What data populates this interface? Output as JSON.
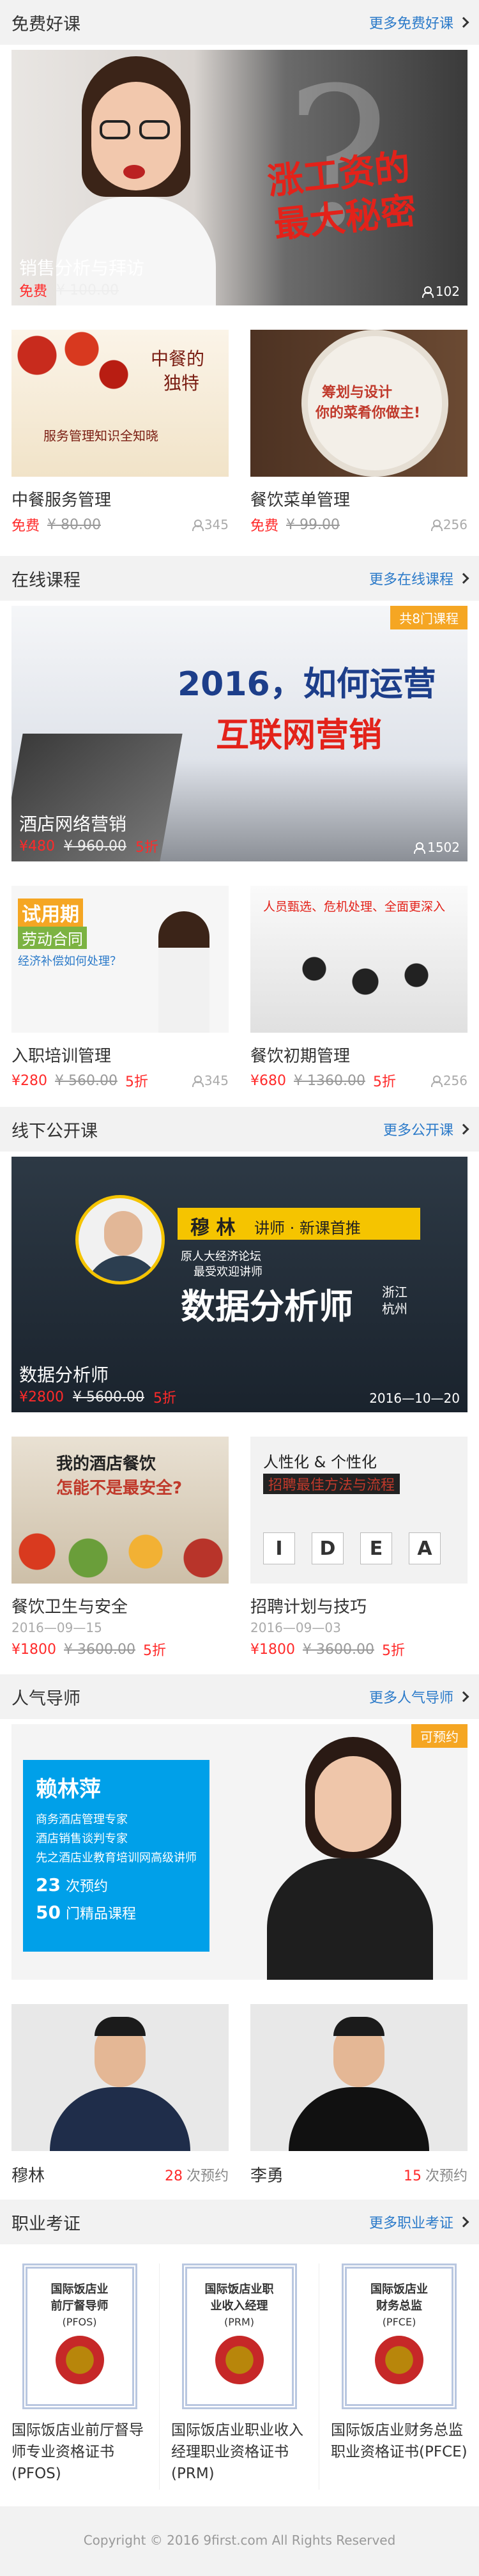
{
  "free": {
    "title": "免费好课",
    "more": "更多免费好课",
    "hero": {
      "caption": "销售分析与拜访",
      "price": "免费",
      "orig": "¥ 100.00",
      "count": "102",
      "banner_line1": "涨工资的",
      "banner_line2": "最大秘密"
    },
    "cards": [
      {
        "name": "中餐服务管理",
        "price": "免费",
        "orig": "¥ 80.00",
        "count": "345",
        "art1": "中餐的",
        "art2": "独特",
        "art3": "服务管理知识全知晓"
      },
      {
        "name": "餐饮菜单管理",
        "price": "免费",
        "orig": "¥ 99.00",
        "count": "256",
        "art1": "筹划与设计",
        "art2": "你的菜肴你做主!"
      }
    ]
  },
  "online": {
    "title": "在线课程",
    "more": "更多在线课程",
    "hero": {
      "caption": "酒店网络营销",
      "tag": "共8门课程",
      "price": "¥480",
      "orig": "¥ 960.00",
      "discount": "5折",
      "count": "1502",
      "banner_line1": "2016，如何运营",
      "banner_line2": "互联网营销"
    },
    "cards": [
      {
        "name": "入职培训管理",
        "price": "¥280",
        "orig": "¥ 560.00",
        "discount": "5折",
        "count": "345",
        "art1": "试用期",
        "art2": "劳动合同",
        "art3": "经济补偿如何处理？"
      },
      {
        "name": "餐饮初期管理",
        "price": "¥680",
        "orig": "¥ 1360.00",
        "discount": "5折",
        "count": "256",
        "art1": "人员甄选、危机处理、全面更深入"
      }
    ]
  },
  "offline": {
    "title": "线下公开课",
    "more": "更多公开课",
    "hero": {
      "caption": "数据分析师",
      "price": "¥2800",
      "orig": "¥ 5600.00",
      "discount": "5折",
      "date": "2016—10—20",
      "teacher": "穆 林",
      "teacher_role": "讲师 · 新课首推",
      "teacher_desc": "原人大经济论坛",
      "teacher_desc2": "最受欢迎讲师",
      "big": "数据分析师",
      "city1": "浙江",
      "city2": "杭州"
    },
    "cards": [
      {
        "name": "餐饮卫生与安全",
        "date": "2016—09—15",
        "price": "¥1800",
        "orig": "¥ 3600.00",
        "discount": "5折",
        "art1": "我的酒店餐饮",
        "art2": "怎能不是最安全?"
      },
      {
        "name": "招聘计划与技巧",
        "date": "2016—09—03",
        "price": "¥1800",
        "orig": "¥ 3600.00",
        "discount": "5折",
        "art1": "人性化 & 个性化",
        "art2": "招聘最佳方法与流程",
        "letters": [
          "I",
          "D",
          "E",
          "A"
        ]
      }
    ]
  },
  "mentor": {
    "title": "人气导师",
    "more": "更多人气导师",
    "hero": {
      "tag": "可预约",
      "name": "赖林萍",
      "desc": [
        "商务酒店管理专家",
        "酒店销售谈判专家",
        "先之酒店业教育培训网高级讲师"
      ],
      "stat1_num": "23",
      "stat1_label": "次预约",
      "stat2_num": "50",
      "stat2_label": "门精品课程"
    },
    "list": [
      {
        "name": "穆林",
        "num": "28",
        "label": "次预约"
      },
      {
        "name": "李勇",
        "num": "15",
        "label": "次预约"
      }
    ]
  },
  "cert": {
    "title": "职业考证",
    "more": "更多职业考证",
    "items": [
      {
        "badge1": "国际饭店业",
        "badge2": "前厅督导师",
        "abbr": "(PFOS)",
        "text": "国际饭店业前厅督导师专业资格证书(PFOS)"
      },
      {
        "badge1": "国际饭店业职",
        "badge2": "业收入经理",
        "abbr": "(PRM)",
        "text": "国际饭店业职业收入经理职业资格证书(PRM)"
      },
      {
        "badge1": "国际饭店业",
        "badge2": "财务总监",
        "abbr": "(PFCE)",
        "text": "国际饭店业财务总监职业资格证书(PFCE)"
      }
    ]
  },
  "footer": "Copyright © 2016 9first.com All Rights Reserved"
}
